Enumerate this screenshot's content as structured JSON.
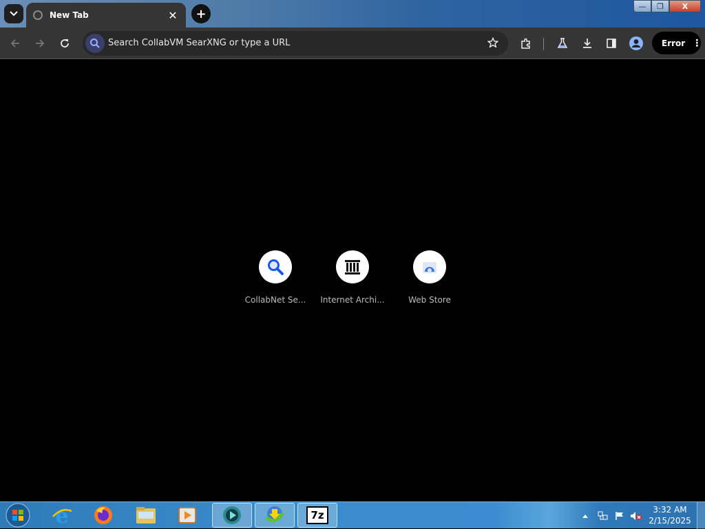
{
  "window": {
    "tab": {
      "title": "New Tab",
      "close": "✕"
    },
    "new_tab": "+",
    "controls": {
      "minimize": "—",
      "maximize": "❐",
      "close": "X"
    }
  },
  "toolbar": {
    "omnibox_placeholder": "Search CollabVM SearXNG or type a URL",
    "profile_error_label": "Error",
    "menu_label": "⋮"
  },
  "shortcuts": [
    {
      "label": "CollabNet Se...",
      "icon": "magnifier-icon"
    },
    {
      "label": "Internet Archi...",
      "icon": "archive-building-icon"
    },
    {
      "label": "Web Store",
      "icon": "web-store-icon"
    }
  ],
  "taskbar": {
    "apps": [
      "start-orb",
      "internet-explorer",
      "firefox",
      "file-explorer",
      "media-player",
      "chrome-like",
      "download-manager",
      "7zip"
    ],
    "sevenzip_label": "7z",
    "clock": {
      "time": "3:32 AM",
      "date": "2/15/2025"
    }
  },
  "colors": {
    "accent_search": "#3b3f6b",
    "shortcut_icon_blue": "#1a56e6"
  }
}
